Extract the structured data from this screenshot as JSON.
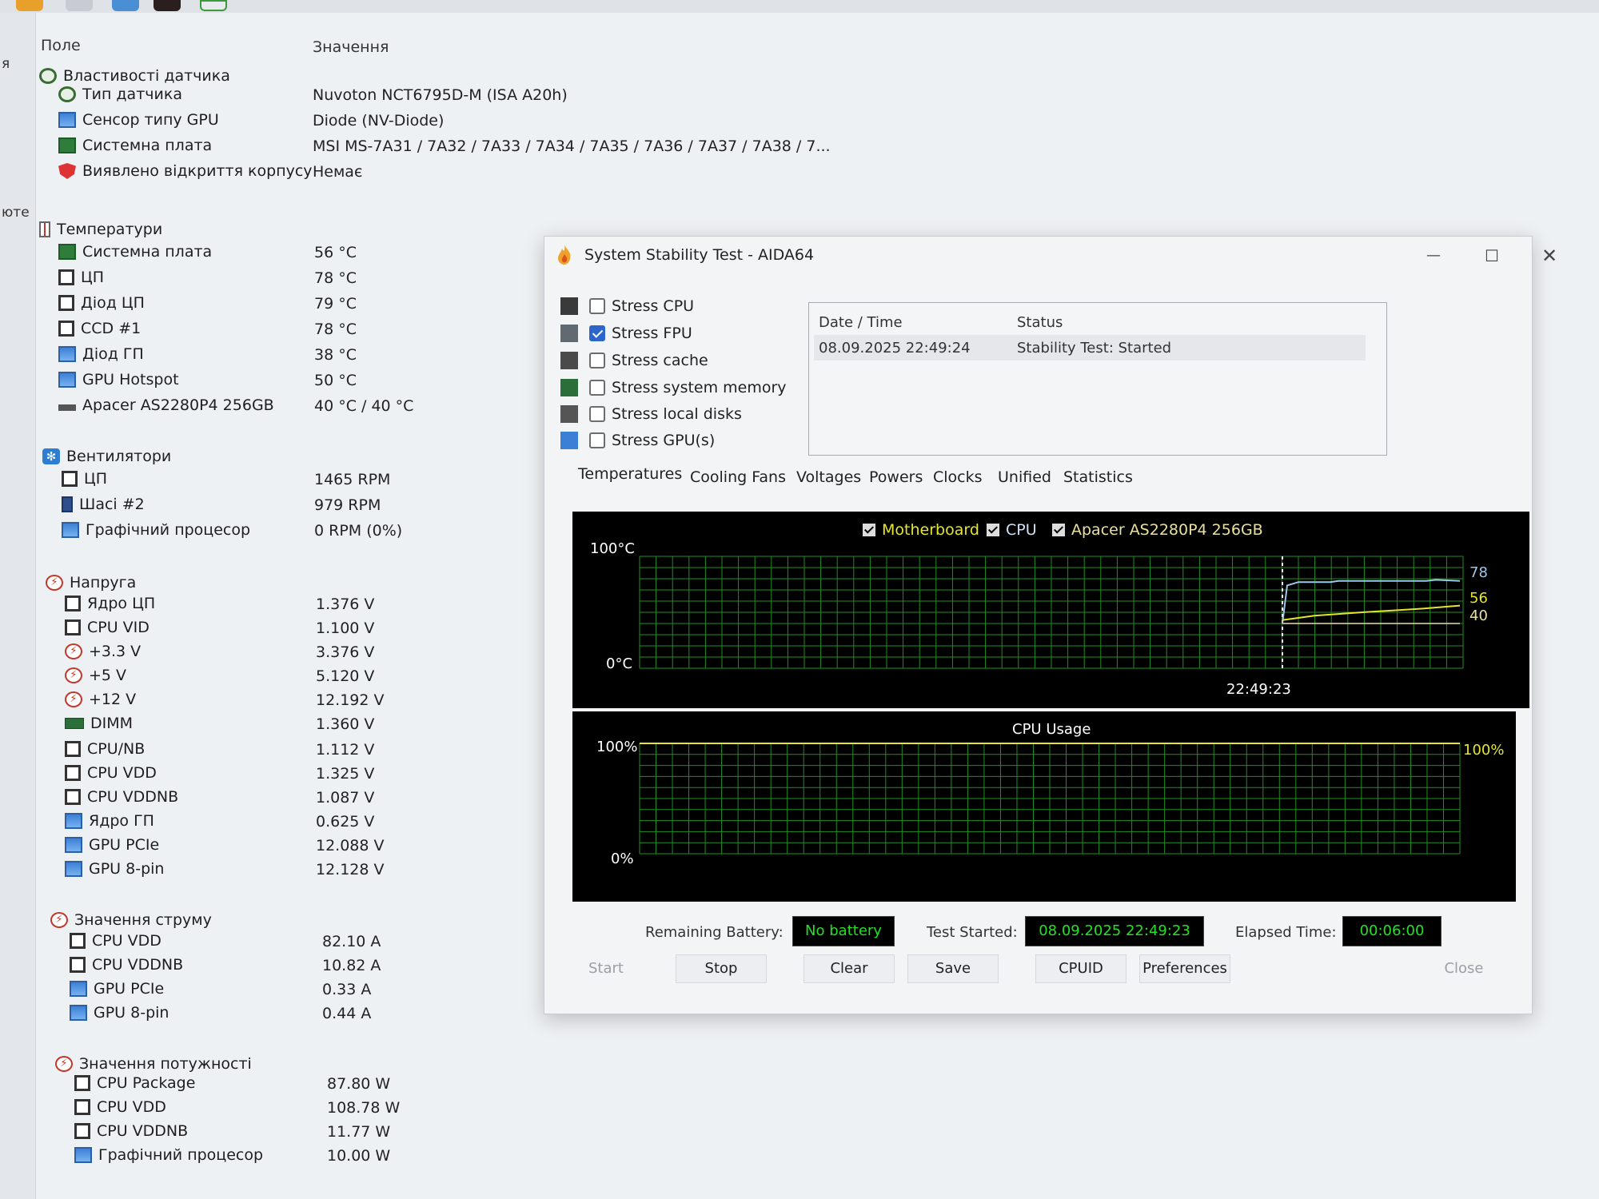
{
  "left_edge": {
    "text_a": "я",
    "text_b": "юте"
  },
  "sensor": {
    "header_field": "Поле",
    "header_value": "Значення",
    "groups": {
      "props": "Властивості датчика",
      "temps": "Температури",
      "fans": "Вентилятори",
      "volts": "Напруга",
      "currents": "Значення струму",
      "powers": "Значення потужності"
    },
    "props": [
      {
        "label": "Тип датчика",
        "value": "Nuvoton NCT6795D-M  (ISA A20h)",
        "icon": "sensor-icon"
      },
      {
        "label": "Сенсор типу GPU",
        "value": "Diode  (NV-Diode)",
        "icon": "monitor-icon"
      },
      {
        "label": "Системна плата",
        "value": "MSI MS-7A31 / 7A32 / 7A33 / 7A34 / 7A35 / 7A36 / 7A37 / 7A38 / 7...",
        "icon": "motherboard-icon"
      },
      {
        "label": "Виявлено відкриття корпусу",
        "value": "Немає",
        "icon": "shield-icon"
      }
    ],
    "temps": [
      {
        "label": "Системна плата",
        "value": "56 °C",
        "icon": "motherboard-icon"
      },
      {
        "label": "ЦП",
        "value": "78 °C",
        "icon": "cpu-icon"
      },
      {
        "label": "Діод ЦП",
        "value": "79 °C",
        "icon": "cpu-icon"
      },
      {
        "label": "CCD #1",
        "value": "78 °C",
        "icon": "cpu-icon"
      },
      {
        "label": "Діод ГП",
        "value": "38 °C",
        "icon": "monitor-icon"
      },
      {
        "label": "GPU Hotspot",
        "value": "50 °C",
        "icon": "monitor-icon"
      },
      {
        "label": "Apacer AS2280P4 256GB",
        "value": "40 °C / 40 °C",
        "icon": "ssd-icon"
      }
    ],
    "fans": [
      {
        "label": "ЦП",
        "value": "1465 RPM",
        "icon": "cpu-icon"
      },
      {
        "label": "Шасі #2",
        "value": "979 RPM",
        "icon": "case-icon"
      },
      {
        "label": "Графічний процесор",
        "value": "0 RPM  (0%)",
        "icon": "monitor-icon"
      }
    ],
    "volts": [
      {
        "label": "Ядро ЦП",
        "value": "1.376 V",
        "icon": "cpu-icon"
      },
      {
        "label": "CPU VID",
        "value": "1.100 V",
        "icon": "cpu-icon"
      },
      {
        "label": "+3.3 V",
        "value": "3.376 V",
        "icon": "voltage-icon"
      },
      {
        "label": "+5 V",
        "value": "5.120 V",
        "icon": "voltage-icon"
      },
      {
        "label": "+12 V",
        "value": "12.192 V",
        "icon": "voltage-icon"
      },
      {
        "label": "DIMM",
        "value": "1.360 V",
        "icon": "dimm-icon"
      },
      {
        "label": "CPU/NB",
        "value": "1.112 V",
        "icon": "cpu-icon"
      },
      {
        "label": "CPU VDD",
        "value": "1.325 V",
        "icon": "cpu-icon"
      },
      {
        "label": "CPU VDDNB",
        "value": "1.087 V",
        "icon": "cpu-icon"
      },
      {
        "label": "Ядро ГП",
        "value": "0.625 V",
        "icon": "monitor-icon"
      },
      {
        "label": "GPU PCIe",
        "value": "12.088 V",
        "icon": "monitor-icon"
      },
      {
        "label": "GPU 8-pin",
        "value": "12.128 V",
        "icon": "monitor-icon"
      }
    ],
    "currents": [
      {
        "label": "CPU VDD",
        "value": "82.10 A",
        "icon": "cpu-icon"
      },
      {
        "label": "CPU VDDNB",
        "value": "10.82 A",
        "icon": "cpu-icon"
      },
      {
        "label": "GPU PCIe",
        "value": "0.33 A",
        "icon": "monitor-icon"
      },
      {
        "label": "GPU 8-pin",
        "value": "0.44 A",
        "icon": "monitor-icon"
      }
    ],
    "powers": [
      {
        "label": "CPU Package",
        "value": "87.80 W",
        "icon": "cpu-icon"
      },
      {
        "label": "CPU VDD",
        "value": "108.78 W",
        "icon": "cpu-icon"
      },
      {
        "label": "CPU VDDNB",
        "value": "11.77 W",
        "icon": "cpu-icon"
      },
      {
        "label": "Графічний процесор",
        "value": "10.00 W",
        "icon": "monitor-icon"
      }
    ]
  },
  "sst": {
    "title": "System Stability Test - AIDA64",
    "controls": {
      "minimize": "—",
      "maximize": "☐",
      "close": "✕"
    },
    "options": [
      {
        "label": "Stress CPU",
        "checked": false,
        "icon": "cpu-icon"
      },
      {
        "label": "Stress FPU",
        "checked": true,
        "icon": "fpu-icon"
      },
      {
        "label": "Stress cache",
        "checked": false,
        "icon": "cache-icon"
      },
      {
        "label": "Stress system memory",
        "checked": false,
        "icon": "memory-icon"
      },
      {
        "label": "Stress local disks",
        "checked": false,
        "icon": "disk-icon"
      },
      {
        "label": "Stress GPU(s)",
        "checked": false,
        "icon": "monitor-icon"
      }
    ],
    "log": {
      "col_date": "Date / Time",
      "col_status": "Status",
      "rows": [
        {
          "date": "08.09.2025 22:49:24",
          "status": "Stability Test: Started"
        }
      ]
    },
    "tabs": [
      "Temperatures",
      "Cooling Fans",
      "Voltages",
      "Powers",
      "Clocks",
      "Unified",
      "Statistics"
    ],
    "temp_graph": {
      "legend": [
        "Motherboard",
        "CPU",
        "Apacer AS2280P4 256GB"
      ],
      "y_max": "100°C",
      "y_min": "0°C",
      "time_label": "22:49:23",
      "end_values": [
        "78",
        "56",
        "40"
      ]
    },
    "cpu_graph": {
      "title": "CPU Usage",
      "y_max": "100%",
      "y_min": "0%",
      "end_value": "100%"
    },
    "info": {
      "battery_label": "Remaining Battery:",
      "battery_value": "No battery",
      "started_label": "Test Started:",
      "started_value": "08.09.2025 22:49:23",
      "elapsed_label": "Elapsed Time:",
      "elapsed_value": "00:06:00"
    },
    "buttons": {
      "start": "Start",
      "stop": "Stop",
      "clear": "Clear",
      "save": "Save",
      "cpuid": "CPUID",
      "preferences": "Preferences",
      "close": "Close"
    }
  },
  "colors": {
    "graph_grid": "#1f8f1f",
    "motherboard_line": "#e5e52a",
    "cpu_line": "#9fc7ec",
    "ssd_line": "#e8e0a0",
    "status_text": "#25e025",
    "cpu_usage_line": "#e5e52a"
  },
  "chart_data": [
    {
      "type": "line",
      "title": "",
      "ylim": [
        0,
        100
      ],
      "x": [
        "",
        "22:49:23",
        ""
      ],
      "series": [
        {
          "name": "Motherboard",
          "values": [
            null,
            43,
            56
          ]
        },
        {
          "name": "CPU",
          "values": [
            null,
            78,
            78
          ]
        },
        {
          "name": "Apacer AS2280P4 256GB",
          "values": [
            null,
            40,
            40
          ]
        }
      ]
    },
    {
      "type": "line",
      "title": "CPU Usage",
      "ylim": [
        0,
        100
      ],
      "series": [
        {
          "name": "CPU Usage",
          "values": [
            100,
            100,
            100
          ]
        }
      ]
    }
  ]
}
